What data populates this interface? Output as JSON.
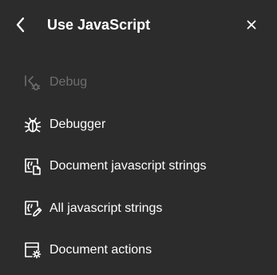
{
  "header": {
    "title": "Use JavaScript",
    "back_icon": "chevron-left-icon",
    "close_icon": "close-icon"
  },
  "menu": {
    "items": [
      {
        "label": "Debug",
        "icon": "debug-step-icon",
        "disabled": true
      },
      {
        "label": "Debugger",
        "icon": "bug-icon",
        "disabled": false
      },
      {
        "label": "Document javascript strings",
        "icon": "document-script-icon",
        "disabled": false
      },
      {
        "label": "All javascript strings",
        "icon": "script-edit-icon",
        "disabled": false
      },
      {
        "label": "Document actions",
        "icon": "document-actions-icon",
        "disabled": false
      }
    ]
  },
  "colors": {
    "background": "#2c2c2c",
    "text": "#ffffff",
    "disabled_text": "#6e6e6e"
  }
}
